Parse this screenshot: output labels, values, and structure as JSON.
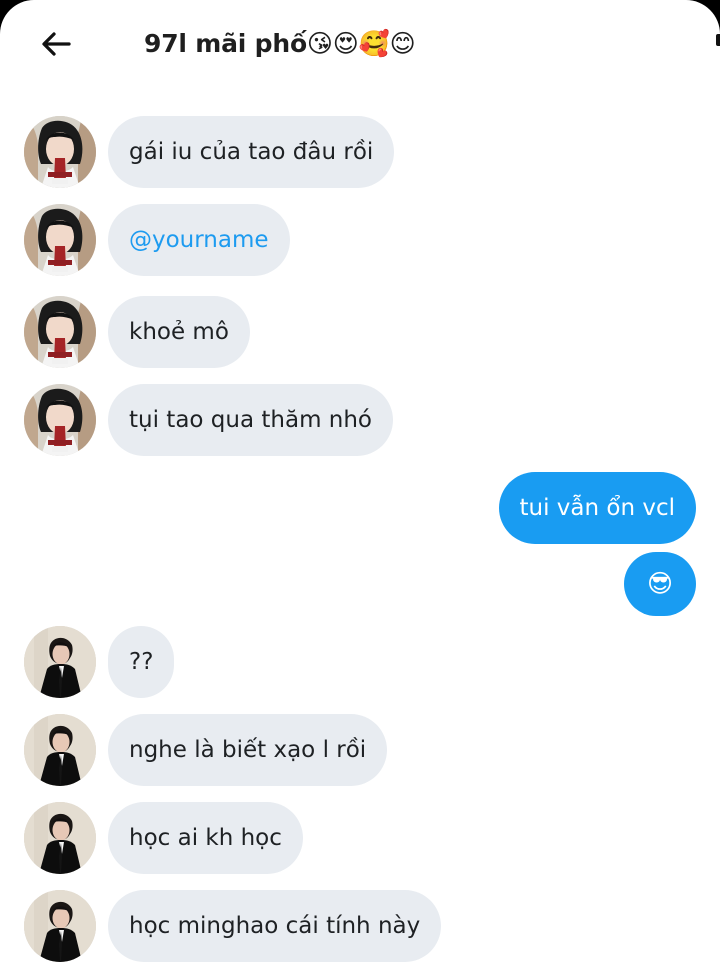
{
  "header": {
    "back_icon": "arrow-left-icon",
    "title": "97l mãi phố😘😍🥰😊"
  },
  "messages": [
    {
      "direction": "incoming",
      "sender_avatar": "girl-avatar",
      "text": "gái iu của tao đâu rồi"
    },
    {
      "direction": "incoming",
      "sender_avatar": "girl-avatar",
      "text": "@yourname"
    },
    {
      "direction": "incoming",
      "sender_avatar": "girl-avatar",
      "text": "khoẻ mô"
    },
    {
      "direction": "incoming",
      "sender_avatar": "girl-avatar",
      "text": "tụi tao qua thăm nhó"
    },
    {
      "direction": "outgoing",
      "text": "tui vẫn ổn vcl"
    },
    {
      "direction": "outgoing",
      "text": "😎"
    },
    {
      "direction": "incoming",
      "sender_avatar": "boy-avatar",
      "text": "??"
    },
    {
      "direction": "incoming",
      "sender_avatar": "boy-avatar",
      "text": "nghe là biết xạo l rồi"
    },
    {
      "direction": "incoming",
      "sender_avatar": "boy-avatar",
      "text": "học ai kh học"
    },
    {
      "direction": "incoming",
      "sender_avatar": "boy-avatar",
      "text": "học minghao cái tính này"
    }
  ],
  "colors": {
    "incoming_bubble": "#e8ecf1",
    "outgoing_bubble": "#199cf2",
    "mention": "#1d9bf0",
    "text_dark": "#1e2124"
  }
}
